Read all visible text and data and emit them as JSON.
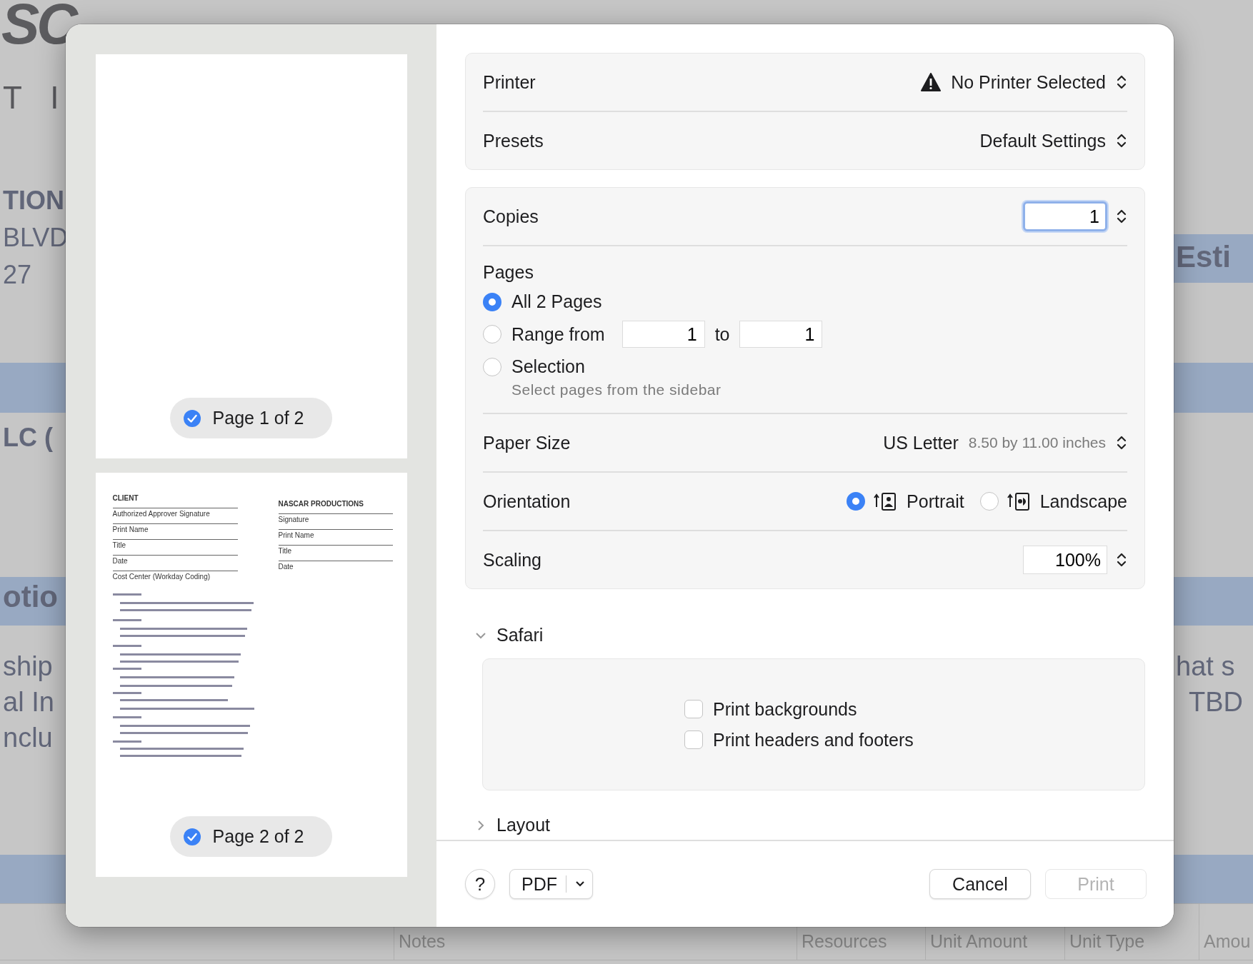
{
  "background": {
    "logo": "SC",
    "texts": [
      {
        "text": "T I",
        "kind": "spaced"
      },
      {
        "text": "TION",
        "kind": "bold"
      },
      {
        "text": "BLVD",
        "kind": "plain"
      },
      {
        "text": "27",
        "kind": "plain"
      },
      {
        "text": "LC (",
        "kind": "bold"
      },
      {
        "text": "otio",
        "kind": "heading"
      },
      {
        "text": "ship",
        "kind": "large"
      },
      {
        "text": "al In",
        "kind": "large"
      },
      {
        "text": "nclu",
        "kind": "large"
      },
      {
        "text": "Esti",
        "kind": "heading"
      },
      {
        "text": "hat s",
        "kind": "large"
      },
      {
        "text": "TBD",
        "kind": "large"
      }
    ],
    "table_columns": [
      "Notes",
      "Resources",
      "Unit Amount",
      "Unit Type",
      "Amou"
    ]
  },
  "sidebar": {
    "pages": [
      {
        "label": "Page 1 of 2",
        "checked": true,
        "kind": "blank"
      },
      {
        "label": "Page 2 of 2",
        "checked": true,
        "kind": "document",
        "document": {
          "left_title": "CLIENT",
          "left_lines": [
            "Authorized Approver Signature",
            "Print Name",
            "Title",
            "Date",
            "Cost Center (Workday Coding)"
          ],
          "right_title": "NASCAR PRODUCTIONS",
          "right_lines": [
            "Signature",
            "Print Name",
            "Title",
            "Date"
          ]
        }
      }
    ]
  },
  "printer": {
    "label": "Printer",
    "value": "No Printer Selected",
    "warning": true
  },
  "presets": {
    "label": "Presets",
    "value": "Default Settings"
  },
  "copies": {
    "label": "Copies",
    "value": "1"
  },
  "pages": {
    "label": "Pages",
    "options": [
      {
        "label": "All 2 Pages",
        "selected": true,
        "kind": "plain"
      },
      {
        "label": "Range from",
        "selected": false,
        "kind": "range",
        "from": "1",
        "to_label": "to",
        "to": "1"
      },
      {
        "label": "Selection",
        "selected": false,
        "kind": "hint",
        "hint": "Select pages from the sidebar"
      }
    ]
  },
  "paper_size": {
    "label": "Paper Size",
    "value": "US Letter",
    "detail": "8.50 by 11.00 inches"
  },
  "orientation": {
    "label": "Orientation",
    "options": [
      {
        "label": "Portrait",
        "selected": true,
        "kind": "portrait"
      },
      {
        "label": "Landscape",
        "selected": false,
        "kind": "landscape"
      }
    ]
  },
  "scaling": {
    "label": "Scaling",
    "value": "100%"
  },
  "sections": [
    {
      "title": "Safari",
      "expanded": true,
      "checkboxes": [
        {
          "label": "Print backgrounds",
          "checked": false
        },
        {
          "label": "Print headers and footers",
          "checked": false
        }
      ]
    },
    {
      "title": "Layout",
      "expanded": false
    }
  ],
  "footer": {
    "help": "?",
    "pdf": "PDF",
    "cancel": "Cancel",
    "print": {
      "label": "Print",
      "disabled": true
    }
  }
}
